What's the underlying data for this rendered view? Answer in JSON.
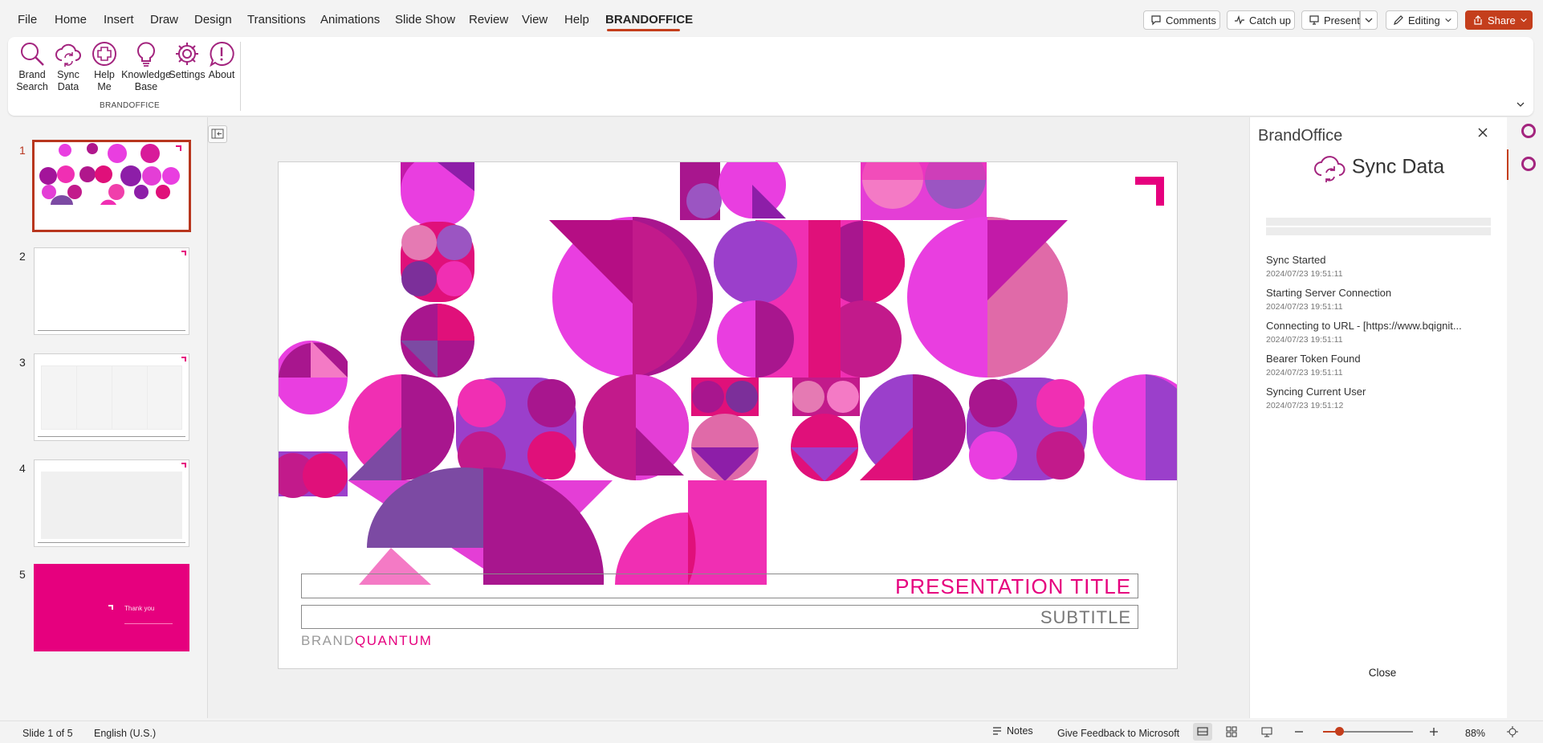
{
  "menu": {
    "items": [
      "File",
      "Home",
      "Insert",
      "Draw",
      "Design",
      "Transitions",
      "Animations",
      "Slide Show",
      "Review",
      "View",
      "Help",
      "BRANDOFFICE"
    ],
    "active": "BRANDOFFICE"
  },
  "topbar": {
    "comments": "Comments",
    "catch_up": "Catch up",
    "present": "Present",
    "editing": "Editing",
    "share": "Share"
  },
  "ribbon": {
    "buttons": [
      {
        "line1": "Brand",
        "line2": "Search",
        "icon": "magnifier-icon"
      },
      {
        "line1": "Sync",
        "line2": "Data",
        "icon": "cloud-sync-icon"
      },
      {
        "line1": "Help",
        "line2": "Me",
        "icon": "plus-circle-icon"
      },
      {
        "line1": "Knowledge",
        "line2": "Base",
        "icon": "lightbulb-icon"
      },
      {
        "line1": "Settings",
        "line2": "",
        "icon": "gear-icon"
      },
      {
        "line1": "About",
        "line2": "",
        "icon": "exclamation-bubble-icon"
      }
    ],
    "group_label": "BRANDOFFICE"
  },
  "thumbnails": {
    "numbers": [
      "1",
      "2",
      "3",
      "4",
      "5"
    ],
    "selected": "1",
    "slide5_text": "Thank you"
  },
  "slide": {
    "title": "PRESENTATION TITLE",
    "subtitle": "SUBTITLE",
    "brand_a": "BRAND",
    "brand_b": "QUANTUM",
    "accent": "#e6007e"
  },
  "pane": {
    "title": "BrandOffice",
    "heading": "Sync Data",
    "log": [
      {
        "text": "Sync Started",
        "time": "2024/07/23 19:51:11"
      },
      {
        "text": "Starting Server Connection",
        "time": "2024/07/23 19:51:11"
      },
      {
        "text": "Connecting to URL - [https://www.bqignit...",
        "time": "2024/07/23 19:51:11"
      },
      {
        "text": "Bearer Token Found",
        "time": "2024/07/23 19:51:11"
      },
      {
        "text": "Syncing Current User",
        "time": "2024/07/23 19:51:12"
      }
    ],
    "close_button": "Close"
  },
  "status": {
    "slide_info": "Slide 1 of 5",
    "language": "English (U.S.)",
    "notes": "Notes",
    "feedback": "Give Feedback to Microsoft",
    "zoom": "88%"
  }
}
